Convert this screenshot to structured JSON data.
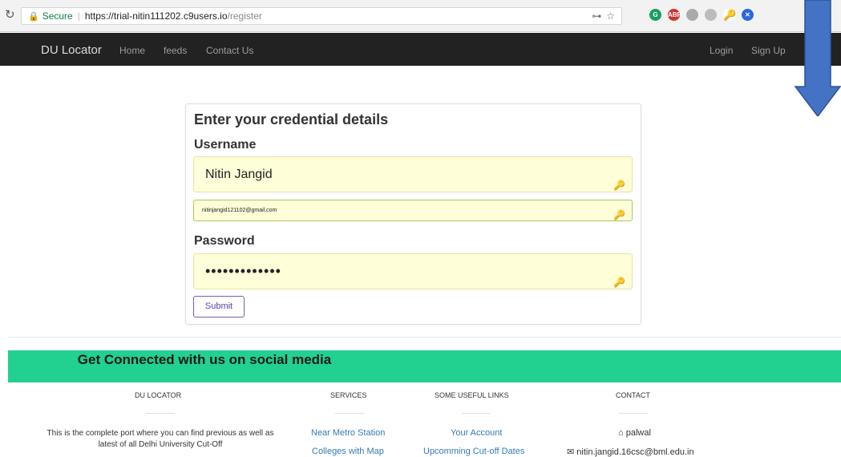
{
  "browser": {
    "reload_icon": "reload-icon",
    "secure_label": "Secure",
    "url_host": "https://trial-nitin111202.c9users.io",
    "url_path": "/register"
  },
  "navbar": {
    "brand": "DU Locator",
    "left": [
      "Home",
      "feeds",
      "Contact Us"
    ],
    "right": [
      "Login",
      "Sign Up"
    ]
  },
  "form": {
    "title": "Enter your credential details",
    "username_label": "Username",
    "username_value": "Nitin Jangid",
    "email_value": "nitinjangid121102@gmail.com",
    "password_label": "Password",
    "password_value": "•••••••••••••",
    "submit_label": "Submit"
  },
  "footer": {
    "social_text": "Get Connected with us on social media",
    "columns": [
      "DU LOCATOR",
      "SERVICES",
      "SOME USEFUL LINKS",
      "CONTACT"
    ],
    "about": "This is the complete port where you can find previous as well as latest of all Delhi University Cut-Off",
    "services": [
      "Near Metro Station",
      "Colleges with Map"
    ],
    "useful_links": [
      "Your Account",
      "Upcomming Cut-off Dates"
    ],
    "contact_place": "palwal",
    "contact_email": "nitin.jangid.16csc@bml.edu.in"
  },
  "colors": {
    "navbar_bg": "#222222",
    "social_bg": "#22d08f",
    "autofill_bg": "#fefed8",
    "link": "#337ab7",
    "arrow": "#4472c4"
  }
}
